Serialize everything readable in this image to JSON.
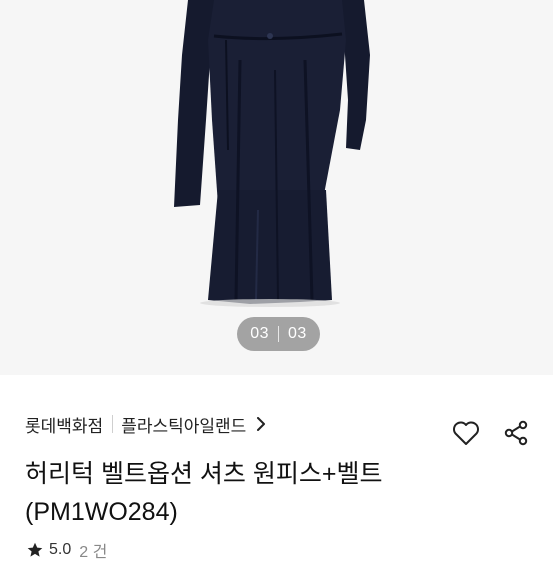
{
  "gallery": {
    "current": "03",
    "total": "03"
  },
  "product": {
    "store": "롯데백화점",
    "brand": "플라스틱아일랜드",
    "title_line1": "허리턱 벨트옵션 셔츠 원피스+벨트",
    "title_line2": "(PM1WO284)",
    "rating": "5.0",
    "review_count": "2 건"
  },
  "icons": {
    "wishlist": "heart-icon",
    "share": "share-icon",
    "brand_link": "chevron-right-icon",
    "rating": "star-icon"
  },
  "colors": {
    "dress": "#151a2e",
    "background": "#f6f6f6"
  }
}
